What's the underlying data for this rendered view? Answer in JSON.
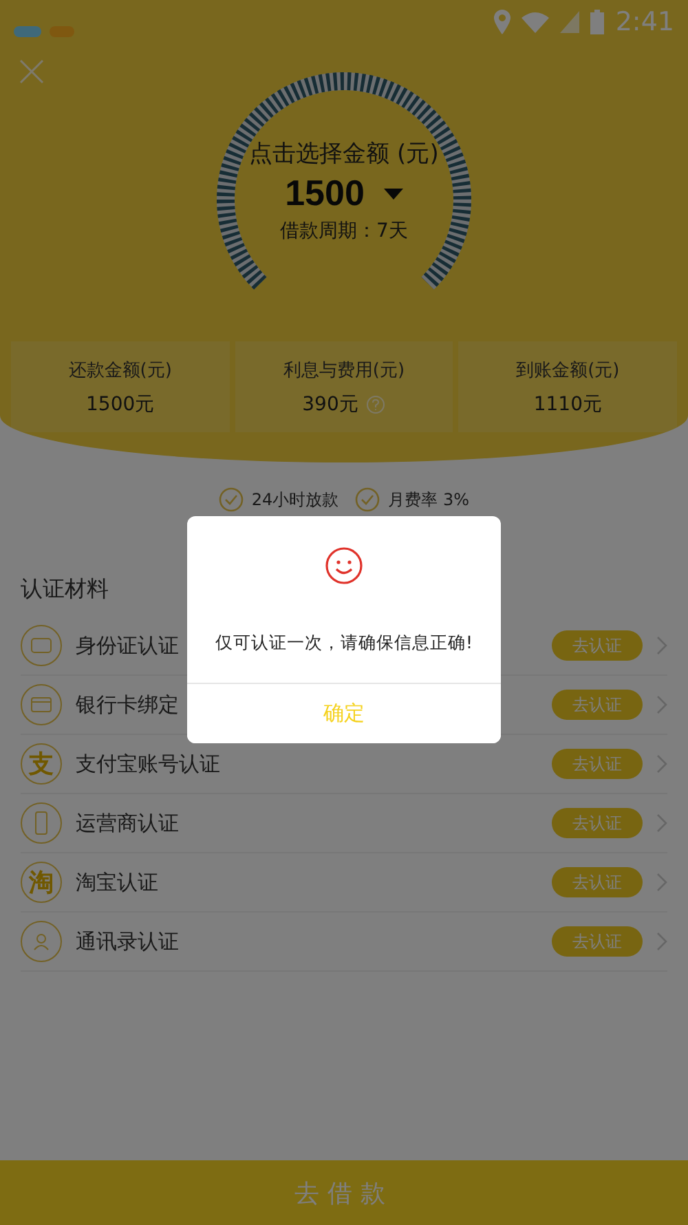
{
  "status_bar": {
    "time": "2:41"
  },
  "loan": {
    "prompt": "点击选择金额 (元)",
    "amount": "1500",
    "period": "借款周期：7天"
  },
  "summary": [
    {
      "label": "还款金额(元)",
      "value": "1500元",
      "info_icon": false
    },
    {
      "label": "利息与费用(元)",
      "value": "390元",
      "info_icon": true
    },
    {
      "label": "到账金额(元)",
      "value": "1110元",
      "info_icon": false
    }
  ],
  "benefits": [
    {
      "text": "24小时放款"
    },
    {
      "text": "月费率 3%"
    }
  ],
  "section_title": "认证材料",
  "verifications": [
    {
      "kind": "id-card",
      "name": "身份证认证",
      "action": "去认证"
    },
    {
      "kind": "bank-card",
      "name": "银行卡绑定",
      "action": "去认证"
    },
    {
      "kind": "glyph",
      "glyph": "支",
      "name": "支付宝账号认证",
      "action": "去认证"
    },
    {
      "kind": "phone",
      "name": "运营商认证",
      "action": "去认证"
    },
    {
      "kind": "glyph",
      "glyph": "淘",
      "name": "淘宝认证",
      "action": "去认证"
    },
    {
      "kind": "contacts",
      "name": "通讯录认证",
      "action": "去认证"
    }
  ],
  "dialog": {
    "message": "仅可认证一次，请确保信息正确!",
    "confirm": "确定"
  },
  "submit": "去借款"
}
